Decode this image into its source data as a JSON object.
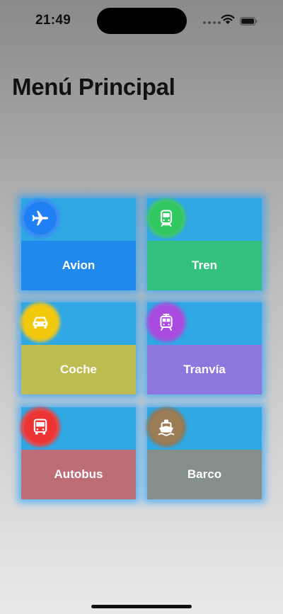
{
  "status_bar": {
    "time": "21:49"
  },
  "page_title": "Menú Principal",
  "menu": [
    {
      "label": "Avion",
      "icon": "airplane-icon",
      "label_bg": "#2289ec",
      "icon_bg": "#1f7ff5",
      "icon_glow": "#3b8df2"
    },
    {
      "label": "Tren",
      "icon": "train-icon",
      "label_bg": "#34c07f",
      "icon_bg": "#30c95f",
      "icon_glow": "#45c670"
    },
    {
      "label": "Coche",
      "icon": "car-icon",
      "label_bg": "#bdbd52",
      "icon_bg": "#f2c90c",
      "icon_glow": "#e9c623"
    },
    {
      "label": "Tranvía",
      "icon": "tram-icon",
      "label_bg": "#8d77de",
      "icon_bg": "#a94ae0",
      "icon_glow": "#9f57da"
    },
    {
      "label": "Autobus",
      "icon": "bus-icon",
      "label_bg": "#bd6d75",
      "icon_bg": "#ed3434",
      "icon_glow": "#e44848"
    },
    {
      "label": "Barco",
      "icon": "ship-icon",
      "label_bg": "#858f8c",
      "icon_bg": "#9c7d55",
      "icon_glow": "#8f7a5e"
    }
  ]
}
